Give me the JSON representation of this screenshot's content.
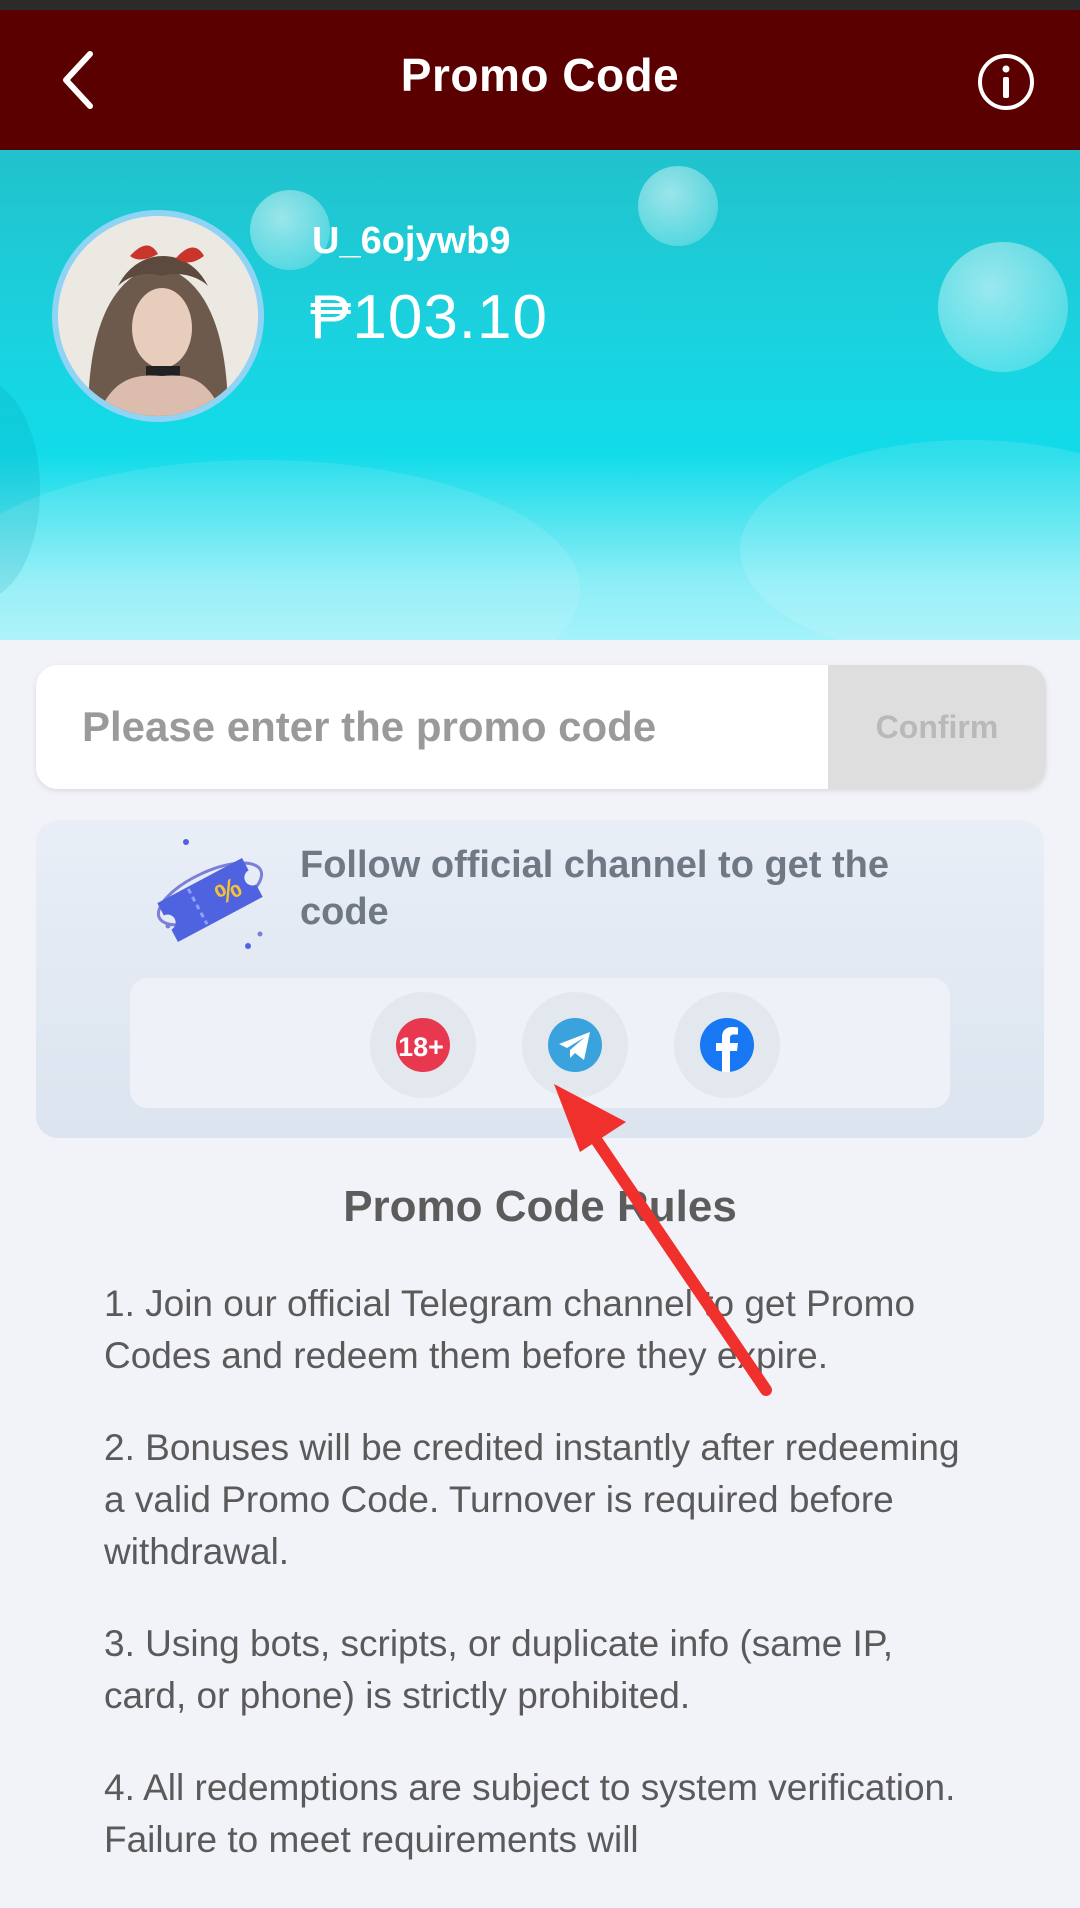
{
  "header": {
    "title": "Promo Code",
    "back_icon": "chevron-left-icon",
    "info_icon": "info-icon"
  },
  "user": {
    "name": "U_6ojywb9",
    "balance": "₱103.10"
  },
  "promo": {
    "placeholder": "Please enter the promo code",
    "value": "",
    "confirm_label": "Confirm"
  },
  "channel": {
    "text": "Follow official channel to get the code",
    "icon": "ticket-icon",
    "socials": [
      {
        "name": "18-plus-icon",
        "label": "18+"
      },
      {
        "name": "telegram-icon",
        "label": ""
      },
      {
        "name": "facebook-icon",
        "label": ""
      }
    ]
  },
  "rules": {
    "title": "Promo Code Rules",
    "items": [
      "1. Join our official Telegram channel to get Promo Codes and redeem them before they expire.",
      "2. Bonuses will be credited instantly after redeeming a valid Promo Code. Turnover is required before withdrawal.",
      "3. Using bots, scripts, or duplicate info (same IP, card, or phone) is strictly prohibited.",
      "4. All redemptions are subject to system verification. Failure to meet requirements will"
    ]
  },
  "colors": {
    "header_bg": "#5a0000",
    "hero_accent": "#12dbe9",
    "annotation_arrow": "#f0302c"
  }
}
